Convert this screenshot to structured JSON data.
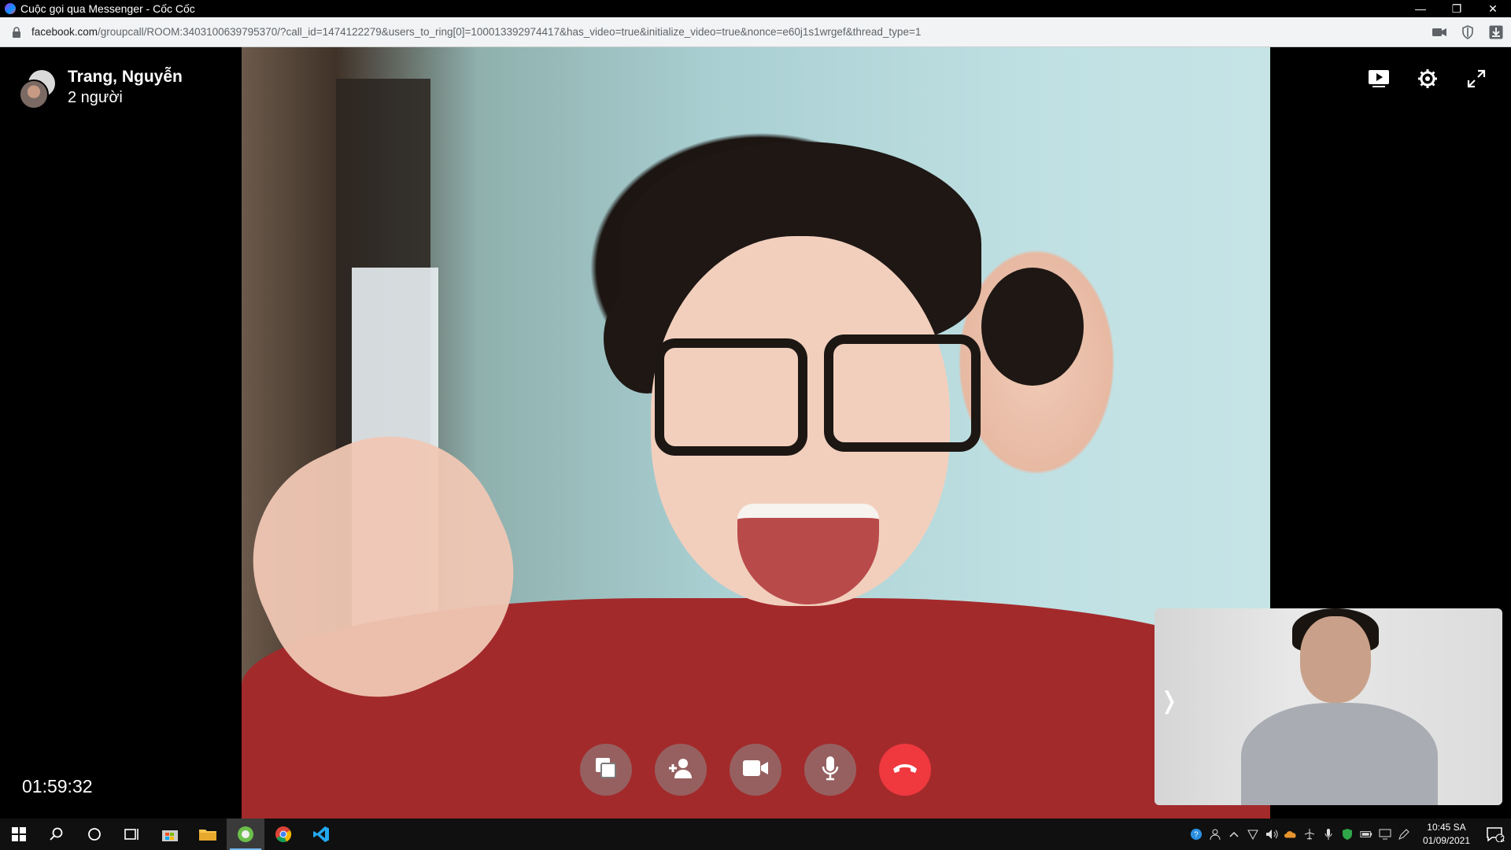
{
  "window": {
    "title": "Cuộc gọi qua Messenger - Cốc Cốc",
    "controls": {
      "minimize": "—",
      "restore": "❐",
      "close": "✕"
    }
  },
  "address_bar": {
    "domain": "facebook.com",
    "path": "/groupcall/ROOM:3403100639795370/?call_id=1474122279&users_to_ring[0]=100013392974417&has_video=true&initialize_video=true&nonce=e60j1s1wrgef&thread_type=1"
  },
  "call": {
    "name": "Trang, Nguyễn",
    "participants": "2 người",
    "timer": "01:59:32",
    "self_view_toggle": "❭"
  },
  "controls": {
    "screen_share": "share-screen-icon",
    "add_person": "add-person-icon",
    "video": "video-camera-icon",
    "microphone": "microphone-icon",
    "end_call": "end-call-icon"
  },
  "taskbar": {
    "time": "10:45 SA",
    "date": "01/09/2021",
    "notification_count": "2"
  },
  "colors": {
    "end_call": "#f0383f",
    "control_bg": "#8c8c8c",
    "taskbar": "#101010"
  }
}
